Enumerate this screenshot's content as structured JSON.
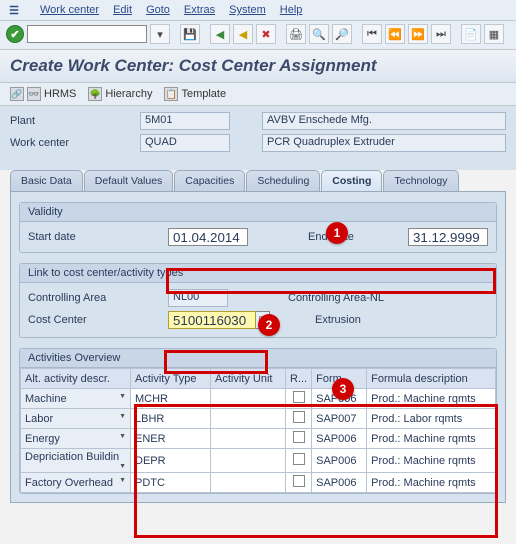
{
  "menubar": {
    "items": [
      "Work center",
      "Edit",
      "Goto",
      "Extras",
      "System",
      "Help"
    ]
  },
  "page_title": "Create Work Center: Cost Center Assignment",
  "sub_buttons": {
    "hrms": "HRMS",
    "hierarchy": "Hierarchy",
    "template": "Template"
  },
  "header": {
    "plant_label": "Plant",
    "plant_value": "5M01",
    "plant_desc": "AVBV Enschede Mfg.",
    "wc_label": "Work center",
    "wc_value": "QUAD",
    "wc_desc": "PCR Quadruplex Extruder"
  },
  "tabs": [
    "Basic Data",
    "Default Values",
    "Capacities",
    "Scheduling",
    "Costing",
    "Technology"
  ],
  "active_tab": 4,
  "validity": {
    "title": "Validity",
    "start_label": "Start date",
    "start_value": "01.04.2014",
    "end_label": "End Date",
    "end_value": "31.12.9999"
  },
  "link": {
    "title": "Link to cost center/activity types",
    "ca_label": "Controlling Area",
    "ca_value": "NL00",
    "ca_desc": "Controlling Area-NL",
    "cc_label": "Cost Center",
    "cc_value": "5100116030",
    "cc_desc": "Extrusion"
  },
  "activities": {
    "title": "Activities Overview",
    "columns": [
      "Alt. activity descr.",
      "Activity Type",
      "Activity Unit",
      "R...",
      "Form...",
      "Formula description"
    ],
    "rows": [
      {
        "descr": "Machine",
        "atype": "MCHR",
        "aunit": "",
        "form": "SAP006",
        "fdesc": "Prod.: Machine rqmts"
      },
      {
        "descr": "Labor",
        "atype": "LBHR",
        "aunit": "",
        "form": "SAP007",
        "fdesc": "Prod.: Labor rqmts"
      },
      {
        "descr": "Energy",
        "atype": "ENER",
        "aunit": "",
        "form": "SAP006",
        "fdesc": "Prod.: Machine rqmts"
      },
      {
        "descr": "Depriciation Buildin",
        "atype": "DEPR",
        "aunit": "",
        "form": "SAP006",
        "fdesc": "Prod.: Machine rqmts"
      },
      {
        "descr": "Factory Overhead",
        "atype": "PDTC",
        "aunit": "",
        "form": "SAP006",
        "fdesc": "Prod.: Machine rqmts"
      }
    ]
  },
  "annotations": {
    "b1": "1",
    "b2": "2",
    "b3": "3"
  }
}
